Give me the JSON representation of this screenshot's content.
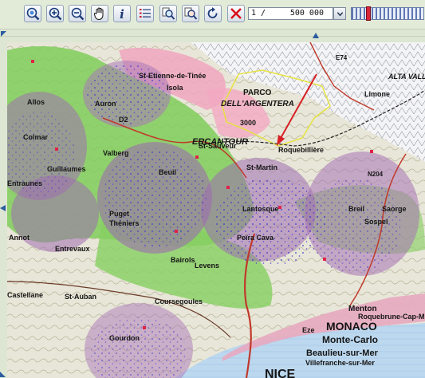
{
  "toolbar": {
    "buttons": [
      {
        "name": "zoom-extent",
        "tooltip": ""
      },
      {
        "name": "zoom-in",
        "tooltip": ""
      },
      {
        "name": "zoom-out",
        "tooltip": ""
      },
      {
        "name": "pan",
        "tooltip": ""
      },
      {
        "name": "info",
        "tooltip": ""
      },
      {
        "name": "legend",
        "tooltip": ""
      },
      {
        "name": "query-a",
        "tooltip": ""
      },
      {
        "name": "query-b",
        "tooltip": ""
      },
      {
        "name": "refresh",
        "tooltip": ""
      },
      {
        "name": "clear",
        "tooltip": ""
      }
    ],
    "scale": {
      "prefix": "1 /",
      "value": "500 000"
    },
    "zoom_level": 0.22
  },
  "map": {
    "labels": {
      "parco": "PARCO",
      "argentera": "DELL'ARGENTERA",
      "alta_valle": "ALTA VALLE",
      "limone": "Limone",
      "monaco": "MONACO",
      "menton": "Menton",
      "roquebrune": "Roquebrune-Cap-M",
      "monte_carlo": "Monte-Carlo",
      "beaulieu": "Beaulieu-sur-Mer",
      "villefranche": "Villefranche-sur-Mer",
      "eze": "Eze",
      "nice": "NICE",
      "auron": "Auron",
      "colmars": "Colmar",
      "allos": "Allos",
      "valberg": "Valberg",
      "beuil": "Beuil",
      "guillaumes": "Guillaumes",
      "entraunes": "Entraunes",
      "annot": "Annot",
      "entrevaux": "Entrevaux",
      "puget": "Puget",
      "theniers": "Théniers",
      "st_sauveur": "St-Sauveur",
      "roquebilliere": "Roquebillière",
      "lantosque": "Lantosque",
      "sospel": "Sospel",
      "breil": "Breil",
      "saorge": "Saorge",
      "levens": "Levens",
      "bairols": "Bairols",
      "st_martin": "St-Martin",
      "peira_cava": "Peïra Cava",
      "st_auban": "St-Auban",
      "gourdon": "Gourdon",
      "coursegoules": "Coursegoules",
      "castellane": "Castellane",
      "isola": "Isola",
      "mercantour": "ERCANTOUR",
      "st_etienne": "St-Etienne-de-Tinée",
      "tende_road": "D2",
      "peak": "3000",
      "e74": "E74",
      "n204": "N204"
    }
  }
}
